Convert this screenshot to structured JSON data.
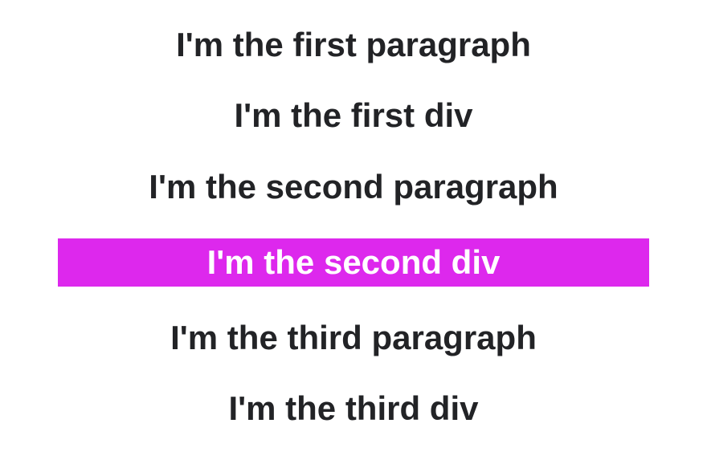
{
  "lines": {
    "p1": "I'm the first paragraph",
    "d1": "I'm the first div",
    "p2": "I'm the second paragraph",
    "d2": "I'm the second div",
    "p3": "I'm the third paragraph",
    "d3": "I'm the third div"
  }
}
